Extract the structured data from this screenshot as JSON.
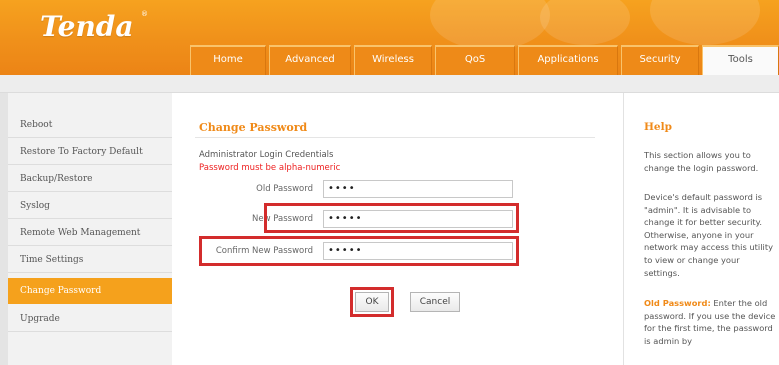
{
  "header": {
    "brand": "Tenda",
    "brand_mark": "®",
    "tabs": [
      {
        "label": "Home"
      },
      {
        "label": "Advanced"
      },
      {
        "label": "Wireless"
      },
      {
        "label": "QoS"
      },
      {
        "label": "Applications"
      },
      {
        "label": "Security"
      },
      {
        "label": "Tools"
      }
    ],
    "active_tab": "Tools"
  },
  "sidebar": {
    "items": [
      {
        "label": "Reboot"
      },
      {
        "label": "Restore To Factory Default"
      },
      {
        "label": "Backup/Restore"
      },
      {
        "label": "Syslog"
      },
      {
        "label": "Remote Web Management"
      },
      {
        "label": "Time Settings"
      },
      {
        "label": "Change Password"
      },
      {
        "label": "Upgrade"
      }
    ],
    "active_item": "Change Password"
  },
  "main": {
    "title": "Change Password",
    "section_heading": "Administrator Login Credentials",
    "note": "Password must be alpha-numeric",
    "fields": {
      "old_password": {
        "label": "Old Password",
        "value": "••••"
      },
      "new_password": {
        "label": "New Password",
        "value": "•••••"
      },
      "confirm_password": {
        "label": "Confirm New Password",
        "value": "•••••"
      }
    },
    "buttons": {
      "ok": "OK",
      "cancel": "Cancel"
    }
  },
  "help": {
    "title": "Help",
    "p1": "This section allows you to change the login password.",
    "p2": "Device's default password is \"admin\". It is advisable to change it for better security. Otherwise, anyone in your network may access this utility to view or change your settings.",
    "p3_term": "Old Password:",
    "p3_text": " Enter the old password. If you use the device for the first time, the password is admin by"
  },
  "colors": {
    "accent_orange": "#f08a18",
    "header_orange": "#f0901a",
    "highlight_red": "#d32c2c",
    "note_red": "#ee2222"
  }
}
